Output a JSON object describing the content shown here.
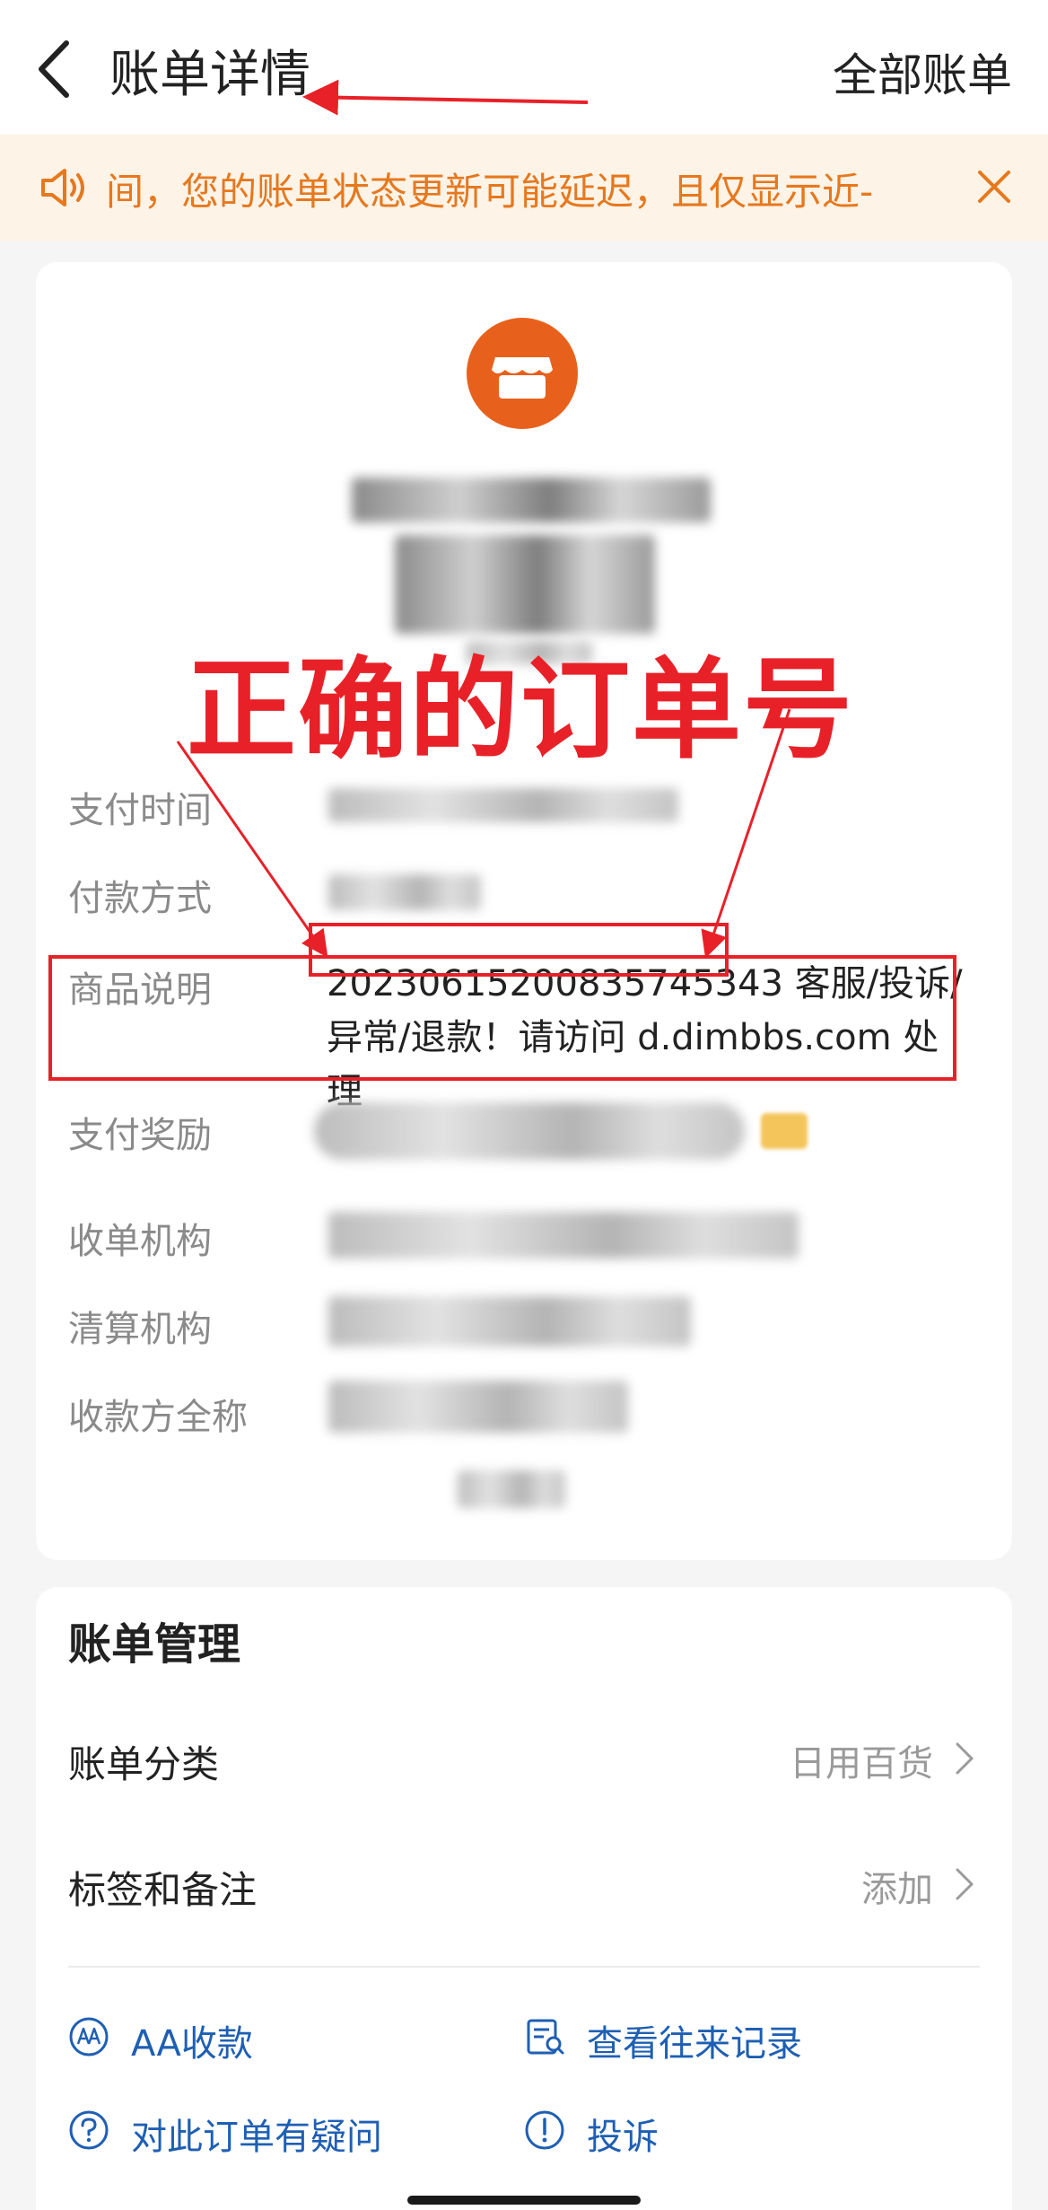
{
  "header": {
    "title": "账单详情",
    "all_bills": "全部账单"
  },
  "notice": {
    "text": "间，您的账单状态更新可能延迟，且仅显示近-"
  },
  "detail": {
    "fields": {
      "pay_time": "支付时间",
      "pay_method": "付款方式",
      "goods_desc": "商品说明",
      "pay_reward": "支付奖励",
      "acquirer": "收单机构",
      "clearing": "清算机构",
      "payee_name": "收款方全称"
    },
    "goods_desc_value": "20230615200835745343 客服/投诉/异常/退款！请访问 d.dimbbs.com 处理"
  },
  "annotation": {
    "label": "正确的订单号"
  },
  "management": {
    "title": "账单管理",
    "category_label": "账单分类",
    "category_value": "日用百货",
    "tags_label": "标签和备注",
    "tags_value": "添加",
    "actions": {
      "aa": "AA收款",
      "history": "查看往来记录",
      "question": "对此订单有疑问",
      "complain": "投诉"
    }
  },
  "colors": {
    "accent_orange": "#e8611c",
    "notice_text": "#e6781e",
    "link_blue": "#1f5fb3",
    "annotation_red": "#e82128"
  }
}
